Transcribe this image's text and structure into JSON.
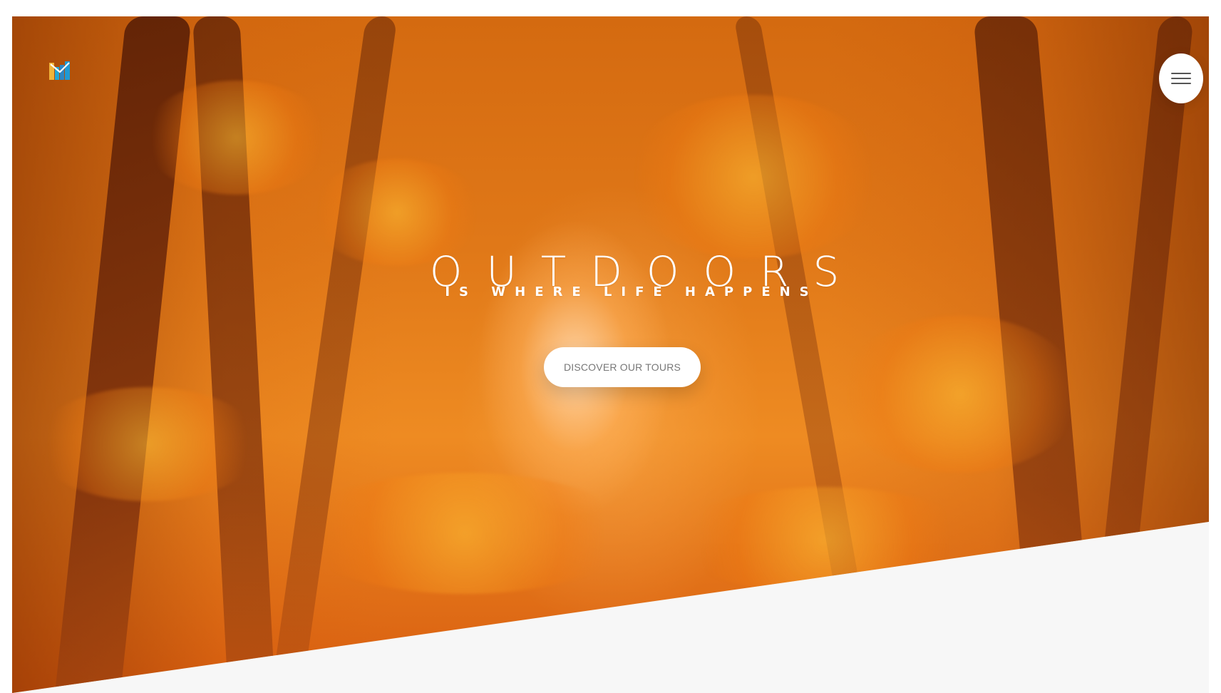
{
  "hero": {
    "title": "OUTDOORS",
    "subtitle": "IS WHERE LIFE HAPPENS",
    "cta_label": "DISCOVER OUR TOURS"
  },
  "header": {
    "logo_icon": "logo-icon",
    "menu_icon": "hamburger-icon"
  },
  "colors": {
    "hero_orange": "#e07818",
    "button_white": "#ffffff",
    "lower_section": "#f7f7f7"
  }
}
